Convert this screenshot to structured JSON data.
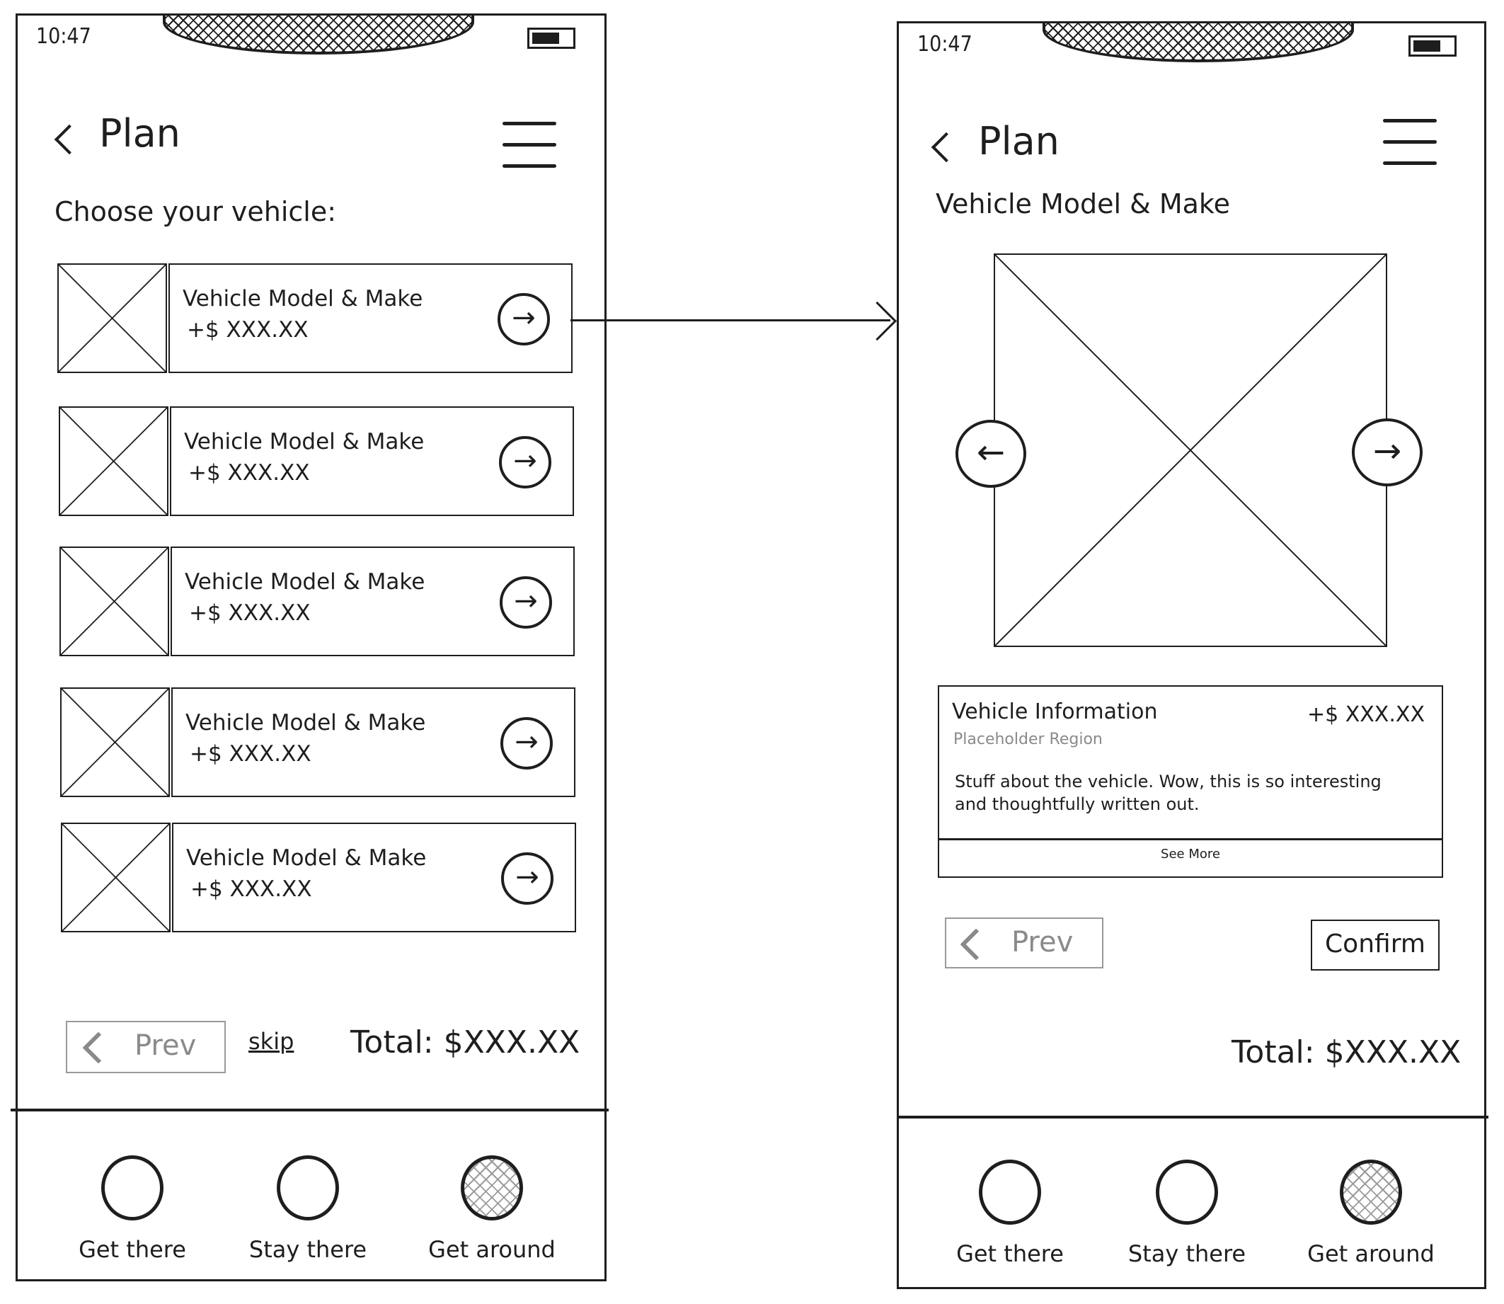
{
  "flow": {
    "connector": "arrow from first vehicle card to detail screen"
  },
  "screens": [
    {
      "id": "vehicle-list",
      "status_bar": {
        "time": "10:47",
        "battery_icon": "battery-icon"
      },
      "header": {
        "back_icon": "chevron-left-icon",
        "title": "Plan",
        "menu_icon": "hamburger-menu-icon"
      },
      "subtitle": "Choose your vehicle:",
      "vehicles": [
        {
          "name": "Vehicle Model & Make",
          "price": "+$ XXX.XX",
          "action_icon": "arrow-right-circle-icon"
        },
        {
          "name": "Vehicle Model & Make",
          "price": "+$ XXX.XX",
          "action_icon": "arrow-right-circle-icon"
        },
        {
          "name": "Vehicle Model & Make",
          "price": "+$ XXX.XX",
          "action_icon": "arrow-right-circle-icon"
        },
        {
          "name": "Vehicle Model & Make",
          "price": "+$ XXX.XX",
          "action_icon": "arrow-right-circle-icon"
        },
        {
          "name": "Vehicle Model & Make",
          "price": "+$ XXX.XX",
          "action_icon": "arrow-right-circle-icon"
        }
      ],
      "footer": {
        "prev_label": "Prev",
        "skip_label": "skip",
        "total": "Total: $XXX.XX"
      },
      "bottom_nav": [
        {
          "label": "Get there",
          "active": false
        },
        {
          "label": "Stay there",
          "active": false
        },
        {
          "label": "Get around",
          "active": true
        }
      ]
    },
    {
      "id": "vehicle-detail",
      "status_bar": {
        "time": "10:47",
        "battery_icon": "battery-icon"
      },
      "header": {
        "back_icon": "chevron-left-icon",
        "title": "Plan",
        "menu_icon": "hamburger-menu-icon"
      },
      "subtitle": "Vehicle Model & Make",
      "carousel": {
        "prev_icon": "arrow-left-circle-icon",
        "next_icon": "arrow-right-circle-icon",
        "prev_glyph": "←",
        "next_glyph": "→"
      },
      "info": {
        "title": "Vehicle Information",
        "price": "+$ XXX.XX",
        "region": "Placeholder Region",
        "description": "Stuff about the vehicle. Wow, this is so interesting and thoughtfully written out.",
        "see_more": "See More"
      },
      "footer": {
        "prev_label": "Prev",
        "confirm_label": "Confirm",
        "total": "Total: $XXX.XX"
      },
      "bottom_nav": [
        {
          "label": "Get there",
          "active": false
        },
        {
          "label": "Stay there",
          "active": false
        },
        {
          "label": "Get around",
          "active": true
        }
      ]
    }
  ],
  "arrow_glyph": "→",
  "colors": {
    "ink": "#1e1e1e",
    "muted": "#8a8a8a",
    "background": "#ffffff"
  }
}
